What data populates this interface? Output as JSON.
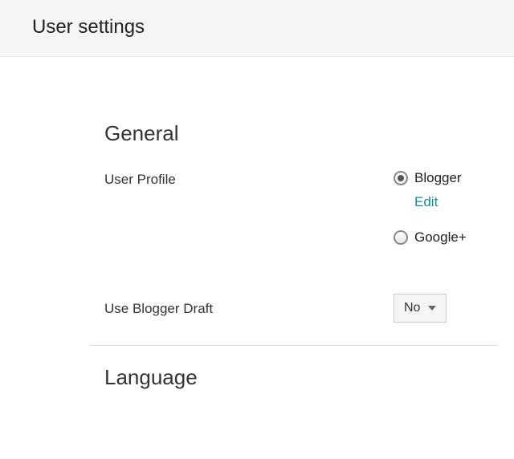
{
  "header": {
    "title": "User settings"
  },
  "general": {
    "title": "General",
    "userProfile": {
      "label": "User Profile",
      "options": {
        "blogger": "Blogger",
        "googlePlus": "Google+"
      },
      "editLabel": "Edit"
    },
    "useBloggerDraft": {
      "label": "Use Blogger Draft",
      "value": "No"
    }
  },
  "language": {
    "title": "Language"
  }
}
